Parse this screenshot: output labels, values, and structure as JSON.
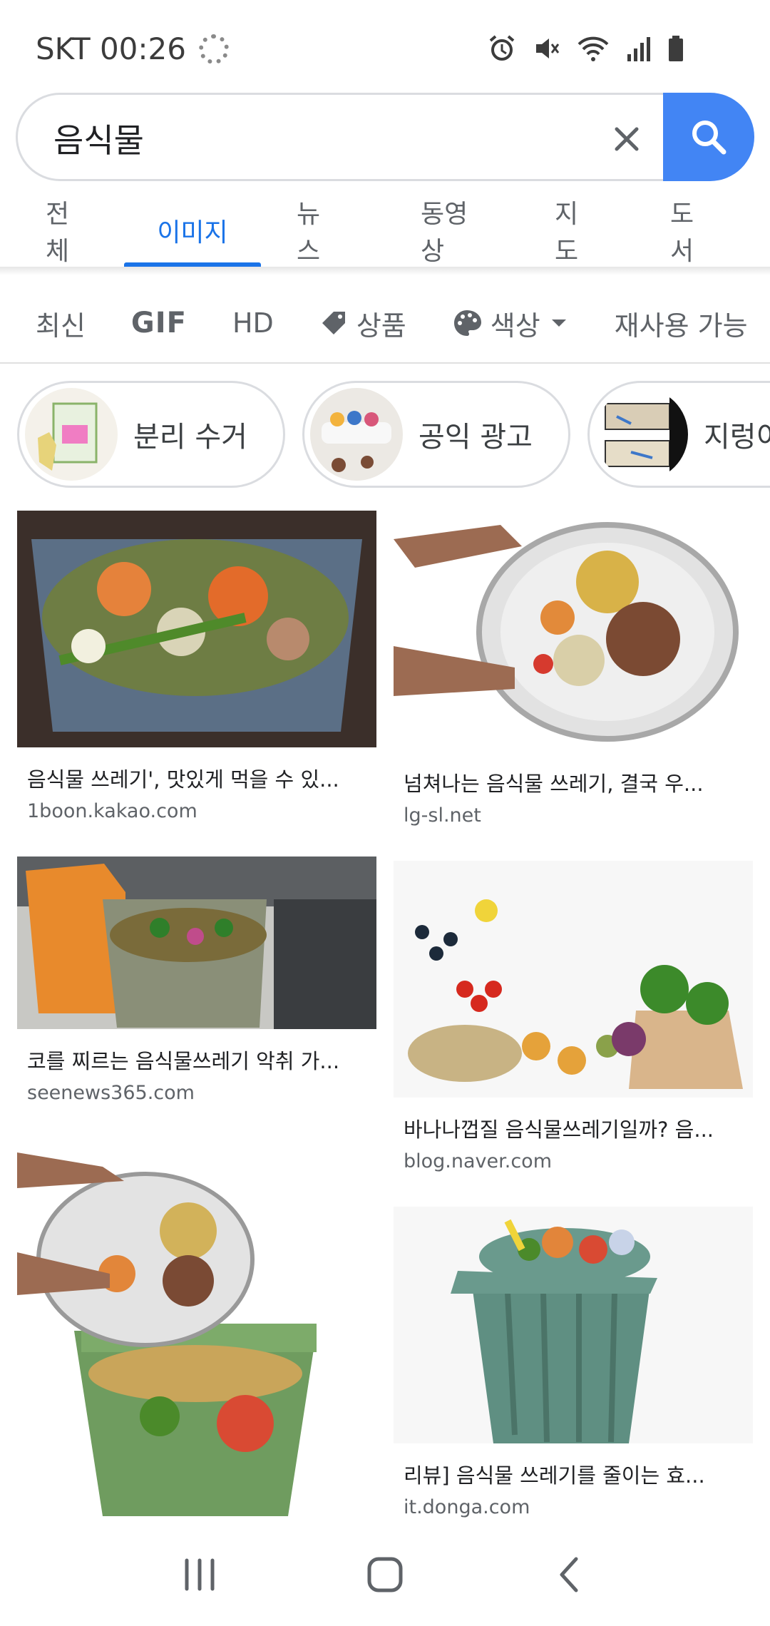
{
  "status": {
    "carrier_time": "SKT 00:26"
  },
  "search": {
    "query": "음식물",
    "clear_icon": "close-icon",
    "search_icon": "search-icon"
  },
  "tabs": [
    {
      "label": "전체"
    },
    {
      "label": "이미지",
      "active": true
    },
    {
      "label": "뉴스"
    },
    {
      "label": "동영상"
    },
    {
      "label": "지도"
    },
    {
      "label": "도서"
    }
  ],
  "filters": [
    {
      "label": "최신"
    },
    {
      "label": "GIF"
    },
    {
      "label": "HD"
    },
    {
      "label": "상품",
      "icon": "tag-icon"
    },
    {
      "label": "색상",
      "icon": "palette-icon"
    },
    {
      "label": "재사용 가능"
    }
  ],
  "related": [
    {
      "label": "분리 수거"
    },
    {
      "label": "공익 광고"
    },
    {
      "label": "지렁이"
    }
  ],
  "results": [
    {
      "title": "음식물 쓰레기', 맛있게 먹을 수 있...",
      "source": "1boon.kakao.com"
    },
    {
      "title": "넘쳐나는 음식물 쓰레기, 결국 우...",
      "source": "lg-sl.net"
    },
    {
      "title": "코를 찌르는 음식물쓰레기 악취 가...",
      "source": "seenews365.com"
    },
    {
      "title": "바나나껍질 음식물쓰레기일까? 음...",
      "source": "blog.naver.com"
    },
    {
      "title": "",
      "source": ""
    },
    {
      "title": "리뷰] 음식물 쓰레기를 줄이는 효...",
      "source": "it.donga.com"
    }
  ],
  "colors": {
    "accent": "#1a73e8",
    "search_button": "#4285f4"
  }
}
